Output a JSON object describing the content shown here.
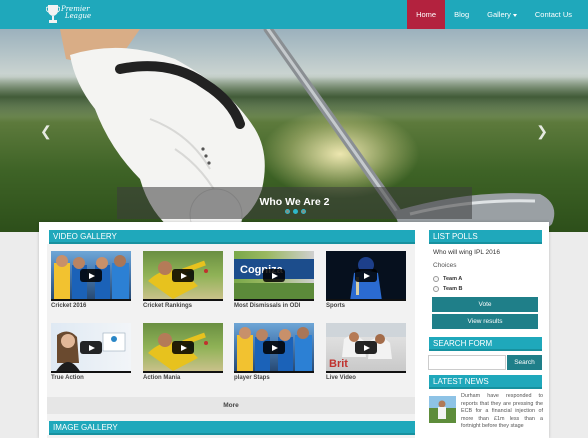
{
  "brand": {
    "logo_text_line1": "Premier",
    "logo_text_line2": "League"
  },
  "nav": {
    "items": [
      {
        "label": "Home",
        "active": true
      },
      {
        "label": "Blog",
        "active": false
      },
      {
        "label": "Gallery",
        "active": false,
        "has_dropdown": true
      },
      {
        "label": "Contact Us",
        "active": false
      }
    ]
  },
  "hero": {
    "caption": "Who We Are 2",
    "prev_icon": "chevron-left-icon",
    "next_icon": "chevron-right-icon",
    "slides_count": 3,
    "active_slide": 2
  },
  "video_gallery": {
    "title": "VIDEO GALLERY",
    "items": [
      {
        "label": "Cricket 2016"
      },
      {
        "label": "Cricket Rankings"
      },
      {
        "label": "Most Dismissals in ODI"
      },
      {
        "label": "Sports"
      },
      {
        "label": "True Action"
      },
      {
        "label": "Action Mania"
      },
      {
        "label": "player Staps"
      },
      {
        "label": "Live Video"
      }
    ],
    "more_label": "More"
  },
  "image_gallery": {
    "title": "IMAGE GALLERY"
  },
  "polls": {
    "title": "LIST POLLS",
    "question": "Who will wing IPL 2016",
    "choices_label": "Choices",
    "options": [
      "Team A",
      "Team B"
    ],
    "vote_label": "Vote",
    "view_results_label": "View results"
  },
  "search": {
    "title": "SEARCH FORM",
    "placeholder": "",
    "button_label": "Search"
  },
  "news": {
    "title": "LATEST NEWS",
    "excerpt": "Durham have responded to reports that they are pressing the ECB for a financial injection of more than £1m less than a fortnight before they stage"
  },
  "colors": {
    "accent": "#1fa8bb",
    "active_nav": "#b3223e",
    "button": "#1f7f89"
  }
}
